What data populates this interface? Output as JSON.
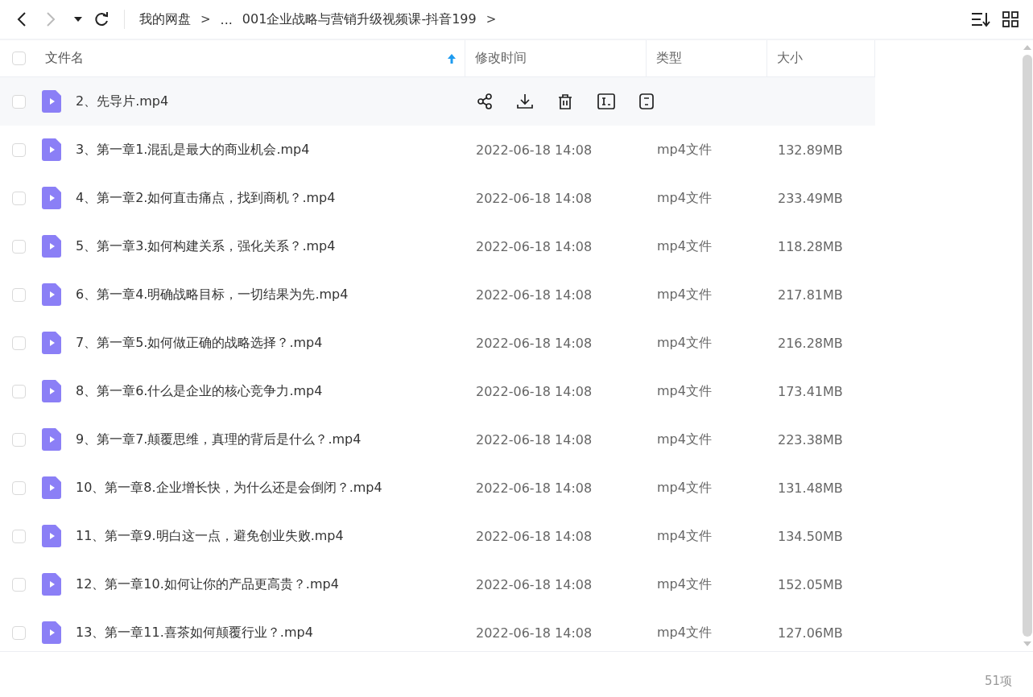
{
  "toolbar": {
    "back_disabled": false,
    "forward_disabled": true,
    "breadcrumb": [
      {
        "kind": "crumb",
        "text": "我的网盘"
      },
      {
        "kind": "sep",
        "text": ">"
      },
      {
        "kind": "crumb",
        "text": "..."
      },
      {
        "kind": "crumb",
        "text": "001企业战略与营销升级视频课-抖音199"
      },
      {
        "kind": "sep",
        "text": ">"
      }
    ]
  },
  "table": {
    "select_all_checked": false,
    "columns": [
      {
        "label": "文件名",
        "sorted": true
      },
      {
        "label": "修改时间",
        "sorted": false
      },
      {
        "label": "类型",
        "sorted": false
      },
      {
        "label": "大小",
        "sorted": false
      }
    ],
    "rows": [
      {
        "name": "2、先导片.mp4",
        "checked": false,
        "hovered": true
      },
      {
        "name": "3、第一章1.混乱是最大的商业机会.mp4",
        "checked": false,
        "hovered": false,
        "modified": "2022-06-18 14:08",
        "type": "mp4文件",
        "size": "132.89MB"
      },
      {
        "name": "4、第一章2.如何直击痛点，找到商机？.mp4",
        "checked": false,
        "hovered": false,
        "modified": "2022-06-18 14:08",
        "type": "mp4文件",
        "size": "233.49MB"
      },
      {
        "name": "5、第一章3.如何构建关系，强化关系？.mp4",
        "checked": false,
        "hovered": false,
        "modified": "2022-06-18 14:08",
        "type": "mp4文件",
        "size": "118.28MB"
      },
      {
        "name": "6、第一章4.明确战略目标，一切结果为先.mp4",
        "checked": false,
        "hovered": false,
        "modified": "2022-06-18 14:08",
        "type": "mp4文件",
        "size": "217.81MB"
      },
      {
        "name": "7、第一章5.如何做正确的战略选择？.mp4",
        "checked": false,
        "hovered": false,
        "modified": "2022-06-18 14:08",
        "type": "mp4文件",
        "size": "216.28MB"
      },
      {
        "name": "8、第一章6.什么是企业的核心竞争力.mp4",
        "checked": false,
        "hovered": false,
        "modified": "2022-06-18 14:08",
        "type": "mp4文件",
        "size": "173.41MB"
      },
      {
        "name": "9、第一章7.颠覆思维，真理的背后是什么？.mp4",
        "checked": false,
        "hovered": false,
        "modified": "2022-06-18 14:08",
        "type": "mp4文件",
        "size": "223.38MB"
      },
      {
        "name": "10、第一章8.企业增长快，为什么还是会倒闭？.mp4",
        "checked": false,
        "hovered": false,
        "modified": "2022-06-18 14:08",
        "type": "mp4文件",
        "size": "131.48MB"
      },
      {
        "name": "11、第一章9.明白这一点，避免创业失败.mp4",
        "checked": false,
        "hovered": false,
        "modified": "2022-06-18 14:08",
        "type": "mp4文件",
        "size": "134.50MB"
      },
      {
        "name": "12、第一章10.如何让你的产品更高贵？.mp4",
        "checked": false,
        "hovered": false,
        "modified": "2022-06-18 14:08",
        "type": "mp4文件",
        "size": "152.05MB"
      },
      {
        "name": "13、第一章11.喜茶如何颠覆行业？.mp4",
        "checked": false,
        "hovered": false,
        "modified": "2022-06-18 14:08",
        "type": "mp4文件",
        "size": "127.06MB"
      }
    ]
  },
  "status_bar": {
    "count": "51项"
  }
}
